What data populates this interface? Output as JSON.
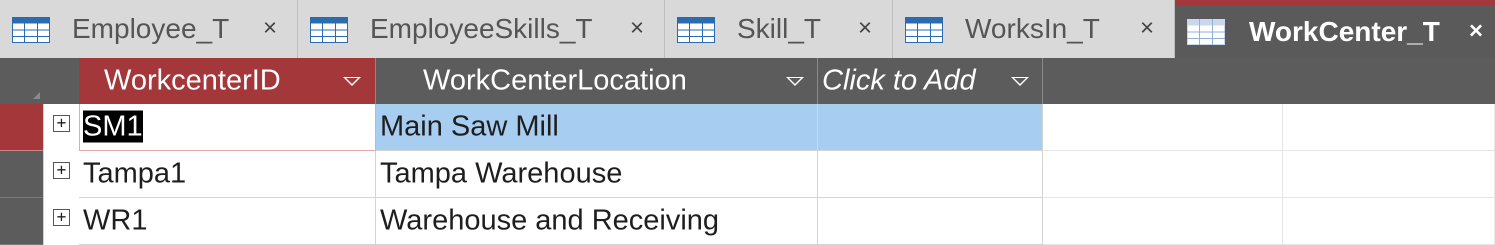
{
  "tabs": [
    {
      "label": "Employee_T",
      "close": "×",
      "active": false
    },
    {
      "label": "EmployeeSkills_T",
      "close": "×",
      "active": false
    },
    {
      "label": "Skill_T",
      "close": "×",
      "active": false
    },
    {
      "label": "WorksIn_T",
      "close": "×",
      "active": false
    },
    {
      "label": "WorkCenter_T",
      "close": "×",
      "active": true
    }
  ],
  "icons": {
    "table": "table-icon",
    "close": "close-icon",
    "expand": "expand-plus-icon",
    "dropdown": "dropdown-arrow-icon"
  },
  "colors": {
    "accent": "#a4373a",
    "header_bg": "#5c5c5c",
    "row_highlight": "#a7cdf0",
    "tabbar_bg": "#d4d4d4"
  },
  "columns": [
    {
      "label": "WorkcenterID"
    },
    {
      "label": "WorkCenterLocation"
    },
    {
      "label": "Click to Add"
    }
  ],
  "rows": [
    {
      "expand": "+",
      "WorkcenterID": "SM1",
      "WorkCenterLocation": "Main Saw Mill"
    },
    {
      "expand": "+",
      "WorkcenterID": "Tampa1",
      "WorkCenterLocation": "Tampa Warehouse"
    },
    {
      "expand": "+",
      "WorkcenterID": "WR1",
      "WorkCenterLocation": "Warehouse and Receiving"
    }
  ]
}
